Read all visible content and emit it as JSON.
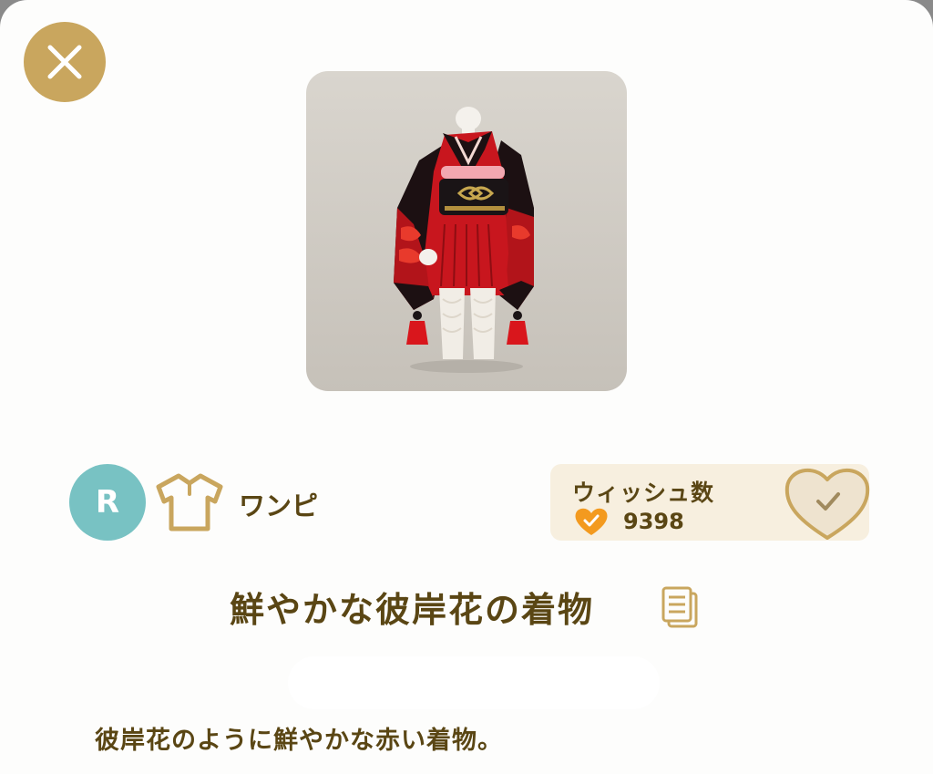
{
  "item": {
    "rarity": "R",
    "category": "ワンピ",
    "name": "鮮やかな彼岸花の着物",
    "description": "彼岸花のように鮮やかな赤い着物。"
  },
  "wish": {
    "label": "ウィッシュ数",
    "count": "9398"
  },
  "colors": {
    "accent_gold": "#c9a65e",
    "text_brown": "#5a4614",
    "rarity_teal": "#78c2c3",
    "heart_orange": "#f39a1f",
    "kimono_red": "#d42a22"
  },
  "icons": {
    "close": "close-icon",
    "category": "shirt-icon",
    "wish_small": "heart-check-icon",
    "wish_button": "heart-outline-check-icon",
    "copy": "copy-icon"
  }
}
